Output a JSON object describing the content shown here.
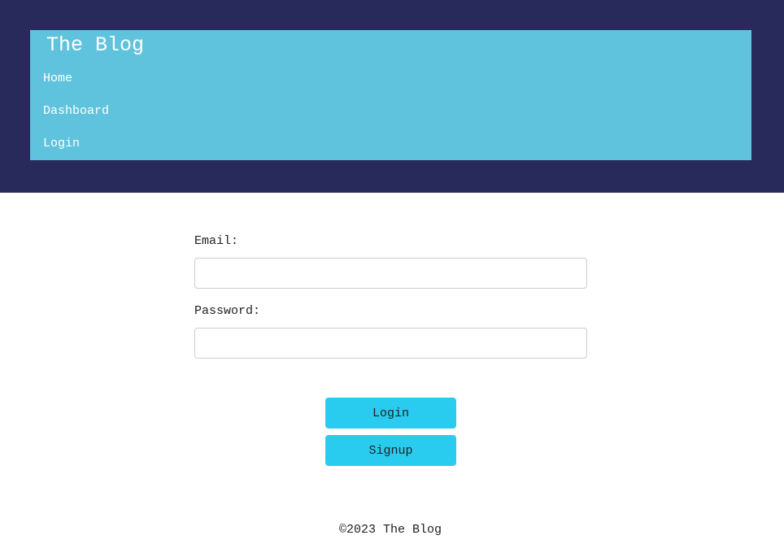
{
  "header": {
    "title": "The Blog",
    "nav": [
      {
        "label": "Home"
      },
      {
        "label": "Dashboard"
      },
      {
        "label": "Login"
      }
    ]
  },
  "login_form": {
    "email_label": "Email:",
    "email_value": "",
    "password_label": "Password:",
    "password_value": "",
    "login_button": "Login",
    "signup_button": "Signup"
  },
  "footer": {
    "copyright": "©2023 The Blog"
  },
  "colors": {
    "header_background": "#282a5b",
    "nav_panel_background": "#5fc3dd",
    "button_background": "#29cbee",
    "page_background": "#ffffff",
    "text": "#222222"
  }
}
